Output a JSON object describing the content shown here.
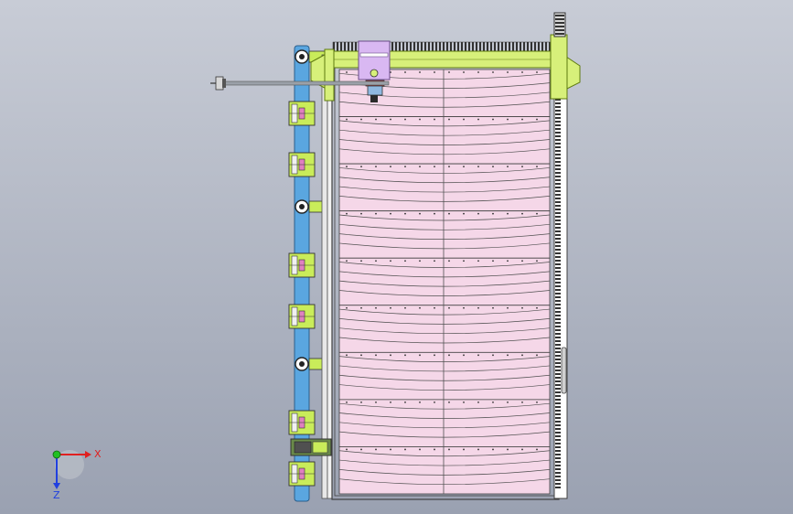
{
  "viewport": {
    "background_top": "#c8ccd6",
    "background_bottom": "#9aa1b1"
  },
  "colors": {
    "panel_fill": "#f5d7e8",
    "panel_stroke": "#404040",
    "frame_yellow": "#d7f07a",
    "frame_yellow_dark": "#9fbf2a",
    "arm_blue": "#5aa6e0",
    "clamp_green": "#c9ec5a",
    "clamp_pink": "#e080c0",
    "carriage_purple": "#d9b8f2",
    "shaft_grey": "#9aa0a8",
    "rack_dark": "#333333",
    "axis_x": "#e02020",
    "axis_y": "#20c020",
    "axis_z": "#2040e0"
  },
  "triad": {
    "x_label": "X",
    "z_label": "Z"
  }
}
